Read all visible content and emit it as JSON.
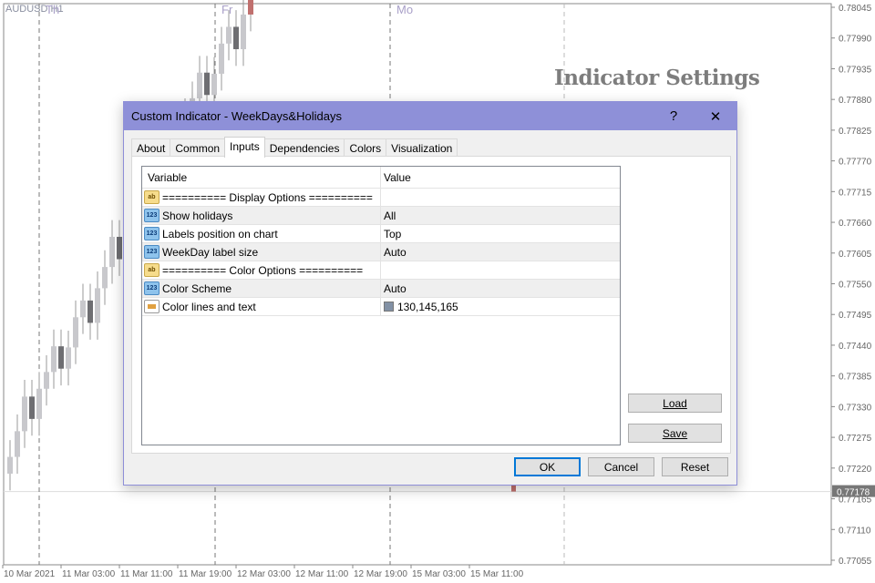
{
  "chart": {
    "symbol": "AUDUSD,H1",
    "days": [
      "Th",
      "Fr",
      "Mo"
    ],
    "headline": "Indicator Settings",
    "price_labels": [
      "0.78045",
      "0.77990",
      "0.77935",
      "0.77880",
      "0.77825",
      "0.77770",
      "0.77715",
      "0.77660",
      "0.77605",
      "0.77550",
      "0.77495",
      "0.77440",
      "0.77385",
      "0.77330",
      "0.77275",
      "0.77220",
      "0.77165",
      "0.77110",
      "0.77055"
    ],
    "current_price": "0.77178",
    "time_labels": [
      "10 Mar 2021",
      "11 Mar 03:00",
      "11 Mar 11:00",
      "11 Mar 19:00",
      "12 Mar 03:00",
      "12 Mar 11:00",
      "12 Mar 19:00",
      "15 Mar 03:00",
      "15 Mar 11:00"
    ],
    "colors": {
      "bull": "#c8c8cc",
      "bear": "#6e6e72",
      "last": "#c0706e",
      "day_label": "#a9a0c8"
    }
  },
  "dialog": {
    "title": "Custom Indicator - WeekDays&Holidays",
    "help": "?",
    "close": "✕",
    "tabs": [
      {
        "label": "About"
      },
      {
        "label": "Common"
      },
      {
        "label": "Inputs",
        "active": true
      },
      {
        "label": "Dependencies"
      },
      {
        "label": "Colors"
      },
      {
        "label": "Visualization"
      }
    ],
    "columns": {
      "variable": "Variable",
      "value": "Value"
    },
    "rows": [
      {
        "icon": "ab",
        "variable": "========== Display Options ==========",
        "value": ""
      },
      {
        "icon": "123",
        "variable": "Show holidays",
        "value": "All"
      },
      {
        "icon": "123",
        "variable": "Labels position on chart",
        "value": "Top"
      },
      {
        "icon": "123",
        "variable": "WeekDay label size",
        "value": "Auto"
      },
      {
        "icon": "ab",
        "variable": "========== Color Options ==========",
        "value": ""
      },
      {
        "icon": "123",
        "variable": "Color Scheme",
        "value": "Auto"
      },
      {
        "icon": "color",
        "variable": "Color lines and text",
        "value": "130,145,165",
        "swatch": "#8291a5"
      }
    ],
    "load": "Load",
    "save": "Save",
    "ok": "OK",
    "cancel": "Cancel",
    "reset": "Reset"
  }
}
